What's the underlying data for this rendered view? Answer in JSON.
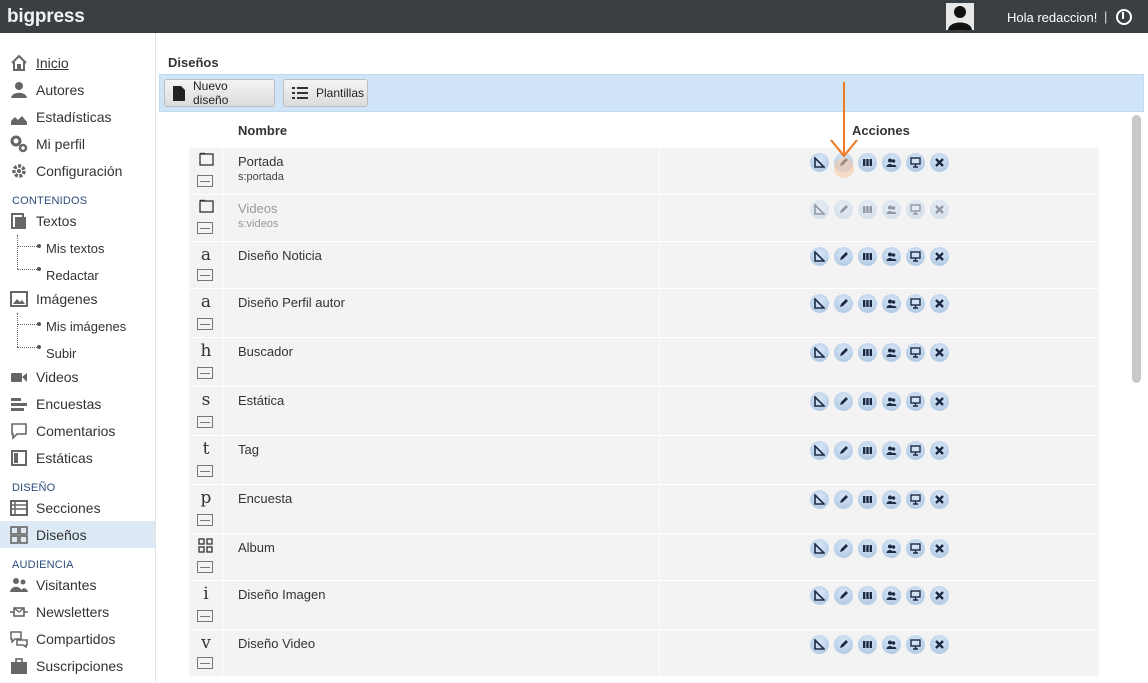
{
  "app": {
    "brand": "bigpress",
    "greeting": "Hola redaccion!",
    "separator": "|"
  },
  "sidebar": {
    "main": [
      {
        "label": "Inicio",
        "icon": "home-icon"
      },
      {
        "label": "Autores",
        "icon": "user-icon"
      },
      {
        "label": "Estadísticas",
        "icon": "chart-icon"
      },
      {
        "label": "Mi perfil",
        "icon": "gears-icon"
      },
      {
        "label": "Configuración",
        "icon": "gear-icon"
      }
    ],
    "contenidos_label": "CONTENIDOS",
    "textos": "Textos",
    "mis_textos": "Mis textos",
    "redactar": "Redactar",
    "imagenes": "Imágenes",
    "mis_imagenes": "Mis imágenes",
    "subir": "Subir",
    "videos": "Videos",
    "encuestas": "Encuestas",
    "comentarios": "Comentarios",
    "estaticas": "Estáticas",
    "diseno_label": "DISEÑO",
    "secciones": "Secciones",
    "disenos": "Diseños",
    "audiencia_label": "AUDIENCIA",
    "visitantes": "Visitantes",
    "newsletters": "Newsletters",
    "compartidos": "Compartidos",
    "suscripciones": "Suscripciones"
  },
  "main": {
    "title": "Diseños",
    "toolbar": {
      "new_design": "Nuevo diseño",
      "templates": "Plantillas"
    },
    "columns": {
      "name": "Nombre",
      "actions": "Acciones"
    },
    "rows": [
      {
        "type": "page",
        "glyph": "",
        "name": "Portada",
        "code": "s:portada",
        "dim": false
      },
      {
        "type": "page",
        "glyph": "",
        "name": "Videos",
        "code": "s:videos",
        "dim": true
      },
      {
        "type": "letter",
        "glyph": "a",
        "name": "Diseño Noticia",
        "code": "",
        "dim": false
      },
      {
        "type": "letter",
        "glyph": "a",
        "name": "Diseño Perfil autor",
        "code": "",
        "dim": false
      },
      {
        "type": "letter",
        "glyph": "h",
        "name": "Buscador",
        "code": "",
        "dim": false
      },
      {
        "type": "letter",
        "glyph": "s",
        "name": "Estática",
        "code": "",
        "dim": false
      },
      {
        "type": "letter",
        "glyph": "t",
        "name": "Tag",
        "code": "",
        "dim": false
      },
      {
        "type": "letter",
        "glyph": "p",
        "name": "Encuesta",
        "code": "",
        "dim": false
      },
      {
        "type": "grid",
        "glyph": "",
        "name": "Album",
        "code": "",
        "dim": false
      },
      {
        "type": "letter",
        "glyph": "i",
        "name": "Diseño Imagen",
        "code": "",
        "dim": false
      },
      {
        "type": "letter",
        "glyph": "v",
        "name": "Diseño Video",
        "code": "",
        "dim": false
      }
    ],
    "action_icons": [
      "layout-icon",
      "edit-pencil-icon",
      "columns-icon",
      "users-icon",
      "preview-monitor-icon",
      "delete-x-icon"
    ],
    "accent_color": "#f07a22"
  }
}
